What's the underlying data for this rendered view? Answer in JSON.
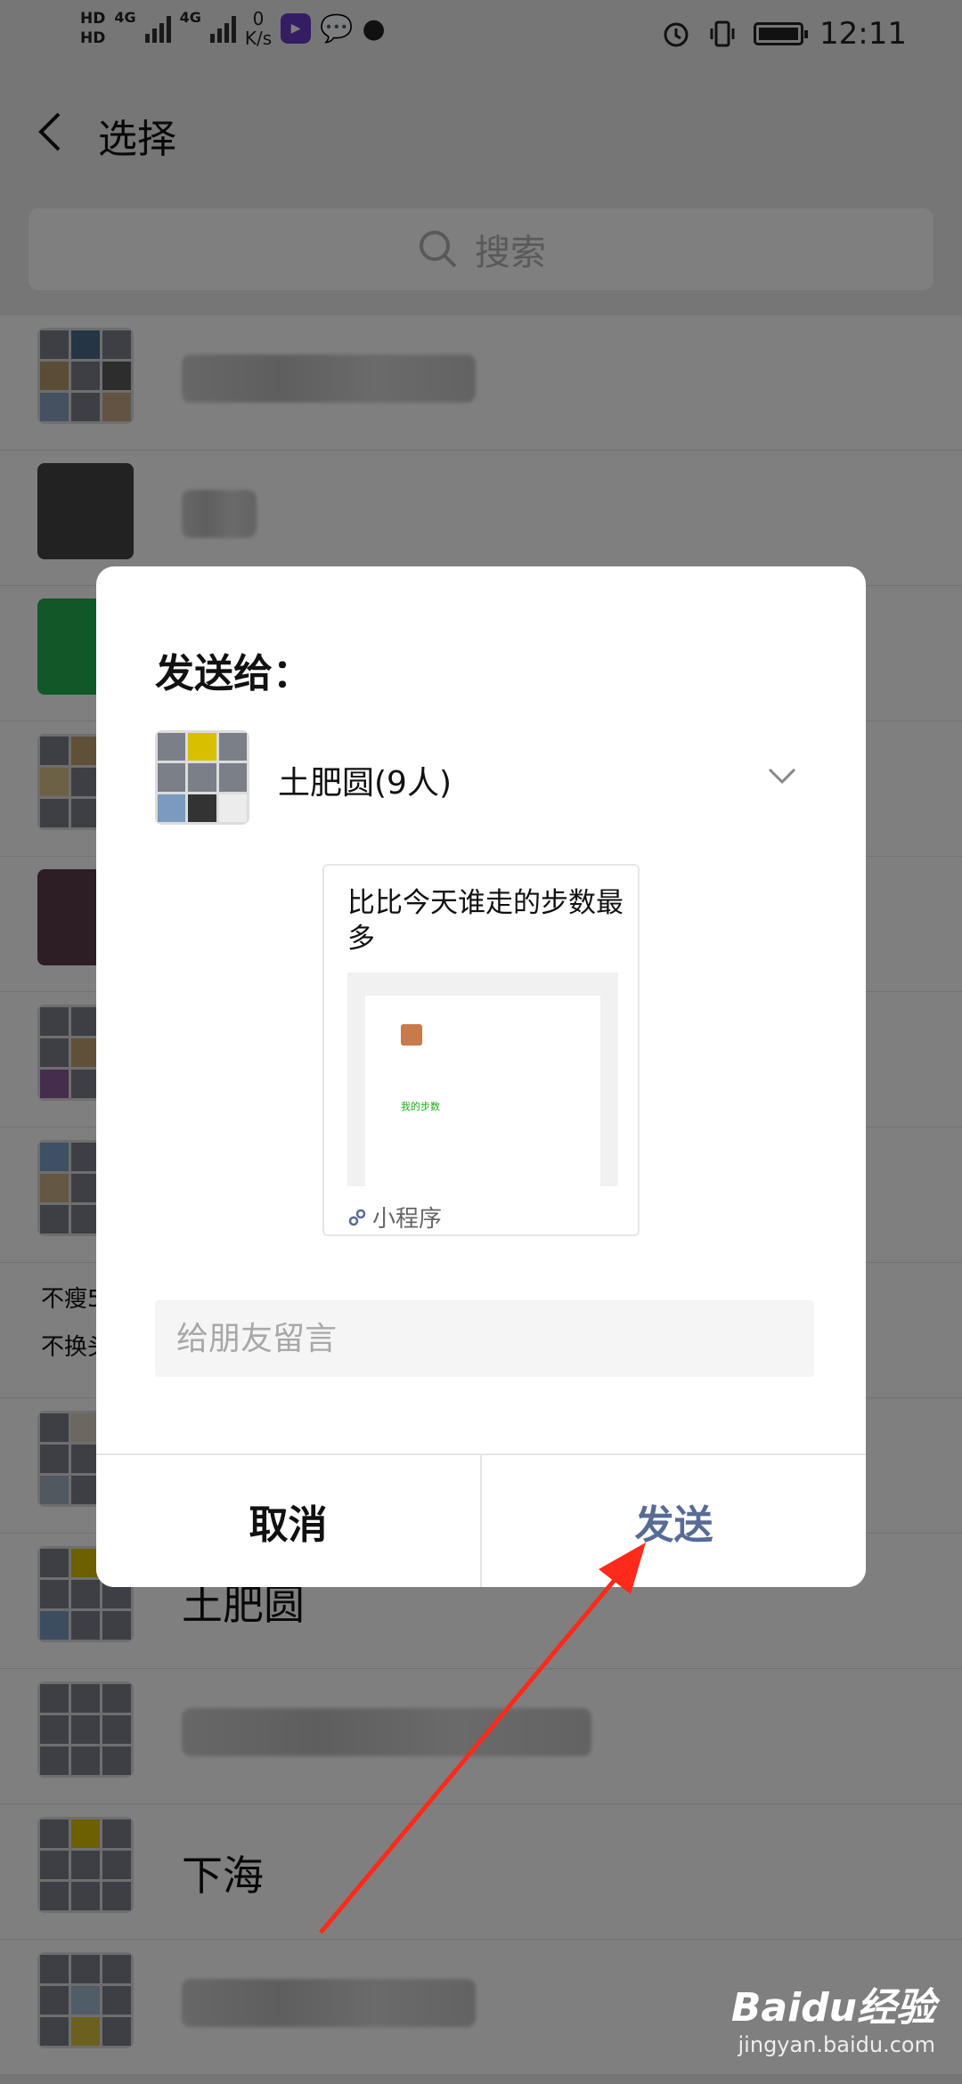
{
  "status": {
    "speed_value": "0",
    "speed_unit": "K/s",
    "time": "12:11"
  },
  "header": {
    "title": "选择"
  },
  "search": {
    "placeholder": "搜索"
  },
  "list": {
    "visible_texts": [
      "不瘦5",
      "不换头"
    ],
    "group_name_a": "土肥圆",
    "group_name_b": "下海"
  },
  "dialog": {
    "title": "发送给：",
    "recipient_name": "土肥圆(9人)",
    "card": {
      "title": "比比今天谁走的步数最多",
      "inner_text": "我的步数",
      "footer": "小程序"
    },
    "message_placeholder": "给朋友留言",
    "cancel_label": "取消",
    "send_label": "发送"
  },
  "watermark": {
    "logo": "Baidu经验",
    "url": "jingyan.baidu.com"
  },
  "colors": {
    "accent": "#576b95",
    "arrow": "#ff2a1a",
    "wechat_green": "#1aad19"
  }
}
